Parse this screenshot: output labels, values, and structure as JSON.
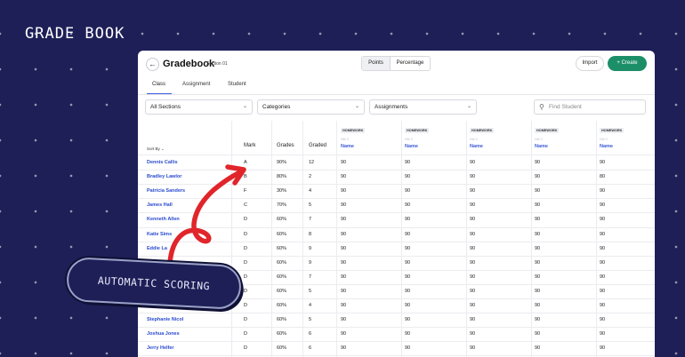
{
  "brand": {
    "title": "GRADE BOOK"
  },
  "header": {
    "title": "Gradebook",
    "subtitle": "Section 01"
  },
  "toggle": {
    "points": "Points",
    "percentage": "Percentage"
  },
  "actions": {
    "import": "Import",
    "create": "Create",
    "plus": "+"
  },
  "tabs": [
    "Class",
    "Assignment",
    "Student"
  ],
  "filters": {
    "sections": "All Sections",
    "categories": "Categories",
    "assignments": "Assignments"
  },
  "search": {
    "placeholder": "Find Student"
  },
  "table": {
    "sort_by": "Sort By",
    "columns": {
      "mark": "Mark",
      "grades": "Grades",
      "graded": "Graded"
    },
    "homework_columns": [
      {
        "tag": "HOMEWORK",
        "sub": "HW 3",
        "name": "Name"
      },
      {
        "tag": "HOMEWORK",
        "sub": "HW 3",
        "name": "Name"
      },
      {
        "tag": "HOMEWORK",
        "sub": "HW 3",
        "name": "Name"
      },
      {
        "tag": "HOMEWORK",
        "sub": "HW 3",
        "name": "Name"
      },
      {
        "tag": "HOMEWORK",
        "sub": "HW 3",
        "name": "Name"
      }
    ],
    "rows": [
      {
        "student": "Dennis Callis",
        "mark": "A",
        "grade": "90%",
        "graded": "12",
        "scores": [
          "90",
          "90",
          "90",
          "90",
          "90"
        ]
      },
      {
        "student": "Bradley Lawlor",
        "mark": "B",
        "grade": "80%",
        "graded": "2",
        "scores": [
          "90",
          "90",
          "90",
          "90",
          "80"
        ]
      },
      {
        "student": "Patricia Sanders",
        "mark": "F",
        "grade": "30%",
        "graded": "4",
        "scores": [
          "90",
          "90",
          "90",
          "90",
          "90"
        ]
      },
      {
        "student": "James Hall",
        "mark": "C",
        "grade": "70%",
        "graded": "5",
        "scores": [
          "90",
          "90",
          "90",
          "90",
          "90"
        ]
      },
      {
        "student": "Kenneth Allen",
        "mark": "D",
        "grade": "60%",
        "graded": "7",
        "scores": [
          "90",
          "90",
          "90",
          "90",
          "90"
        ]
      },
      {
        "student": "Katie Sims",
        "mark": "D",
        "grade": "60%",
        "graded": "8",
        "scores": [
          "90",
          "90",
          "90",
          "90",
          "90"
        ]
      },
      {
        "student": "Eddie La",
        "mark": "D",
        "grade": "60%",
        "graded": "9",
        "scores": [
          "90",
          "90",
          "90",
          "90",
          "90"
        ]
      },
      {
        "student": "",
        "mark": "D",
        "grade": "60%",
        "graded": "9",
        "scores": [
          "90",
          "90",
          "90",
          "90",
          "90"
        ]
      },
      {
        "student": "",
        "mark": "D",
        "grade": "60%",
        "graded": "7",
        "scores": [
          "90",
          "90",
          "90",
          "90",
          "90"
        ]
      },
      {
        "student": "",
        "mark": "D",
        "grade": "60%",
        "graded": "5",
        "scores": [
          "90",
          "90",
          "90",
          "90",
          "90"
        ]
      },
      {
        "student": "",
        "mark": "D",
        "grade": "60%",
        "graded": "4",
        "scores": [
          "90",
          "90",
          "90",
          "90",
          "90"
        ]
      },
      {
        "student": "Stephanie Nicol",
        "mark": "D",
        "grade": "60%",
        "graded": "5",
        "scores": [
          "90",
          "90",
          "90",
          "90",
          "90"
        ]
      },
      {
        "student": "Joshua Jones",
        "mark": "D",
        "grade": "60%",
        "graded": "6",
        "scores": [
          "90",
          "90",
          "90",
          "90",
          "90"
        ]
      },
      {
        "student": "Jerry Helfer",
        "mark": "D",
        "grade": "60%",
        "graded": "6",
        "scores": [
          "90",
          "90",
          "90",
          "90",
          "90"
        ]
      }
    ]
  },
  "callout": {
    "label": "AUTOMATIC SCORING"
  },
  "colors": {
    "background": "#1e1f57",
    "accent": "#1c8f68",
    "link": "#2b4bcf",
    "arrow": "#e0252b"
  }
}
